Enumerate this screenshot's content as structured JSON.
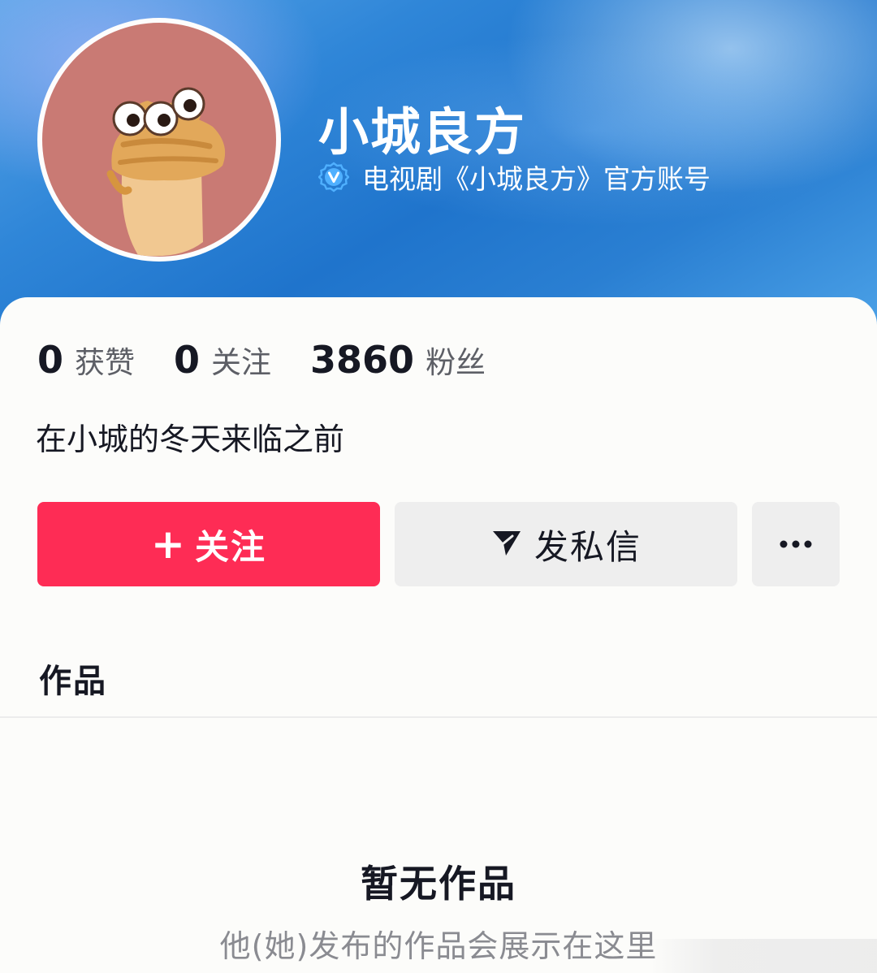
{
  "profile": {
    "name": "小城良方",
    "verification": "电视剧《小城良方》官方账号",
    "bio": "在小城的冬天来临之前"
  },
  "stats": [
    {
      "value": "0",
      "label": "获赞"
    },
    {
      "value": "0",
      "label": "关注"
    },
    {
      "value": "3860",
      "label": "粉丝"
    }
  ],
  "actions": {
    "follow_label": "关注",
    "message_label": "发私信",
    "more_icon": "more-dots-icon"
  },
  "tabs": {
    "works_label": "作品"
  },
  "empty_state": {
    "title": "暂无作品",
    "subtitle": "他(她)发布的作品会展示在这里"
  },
  "colors": {
    "follow_button": "#fe2c55",
    "banner": "#1f74cc",
    "verify_badge": "#3aa0ff"
  }
}
